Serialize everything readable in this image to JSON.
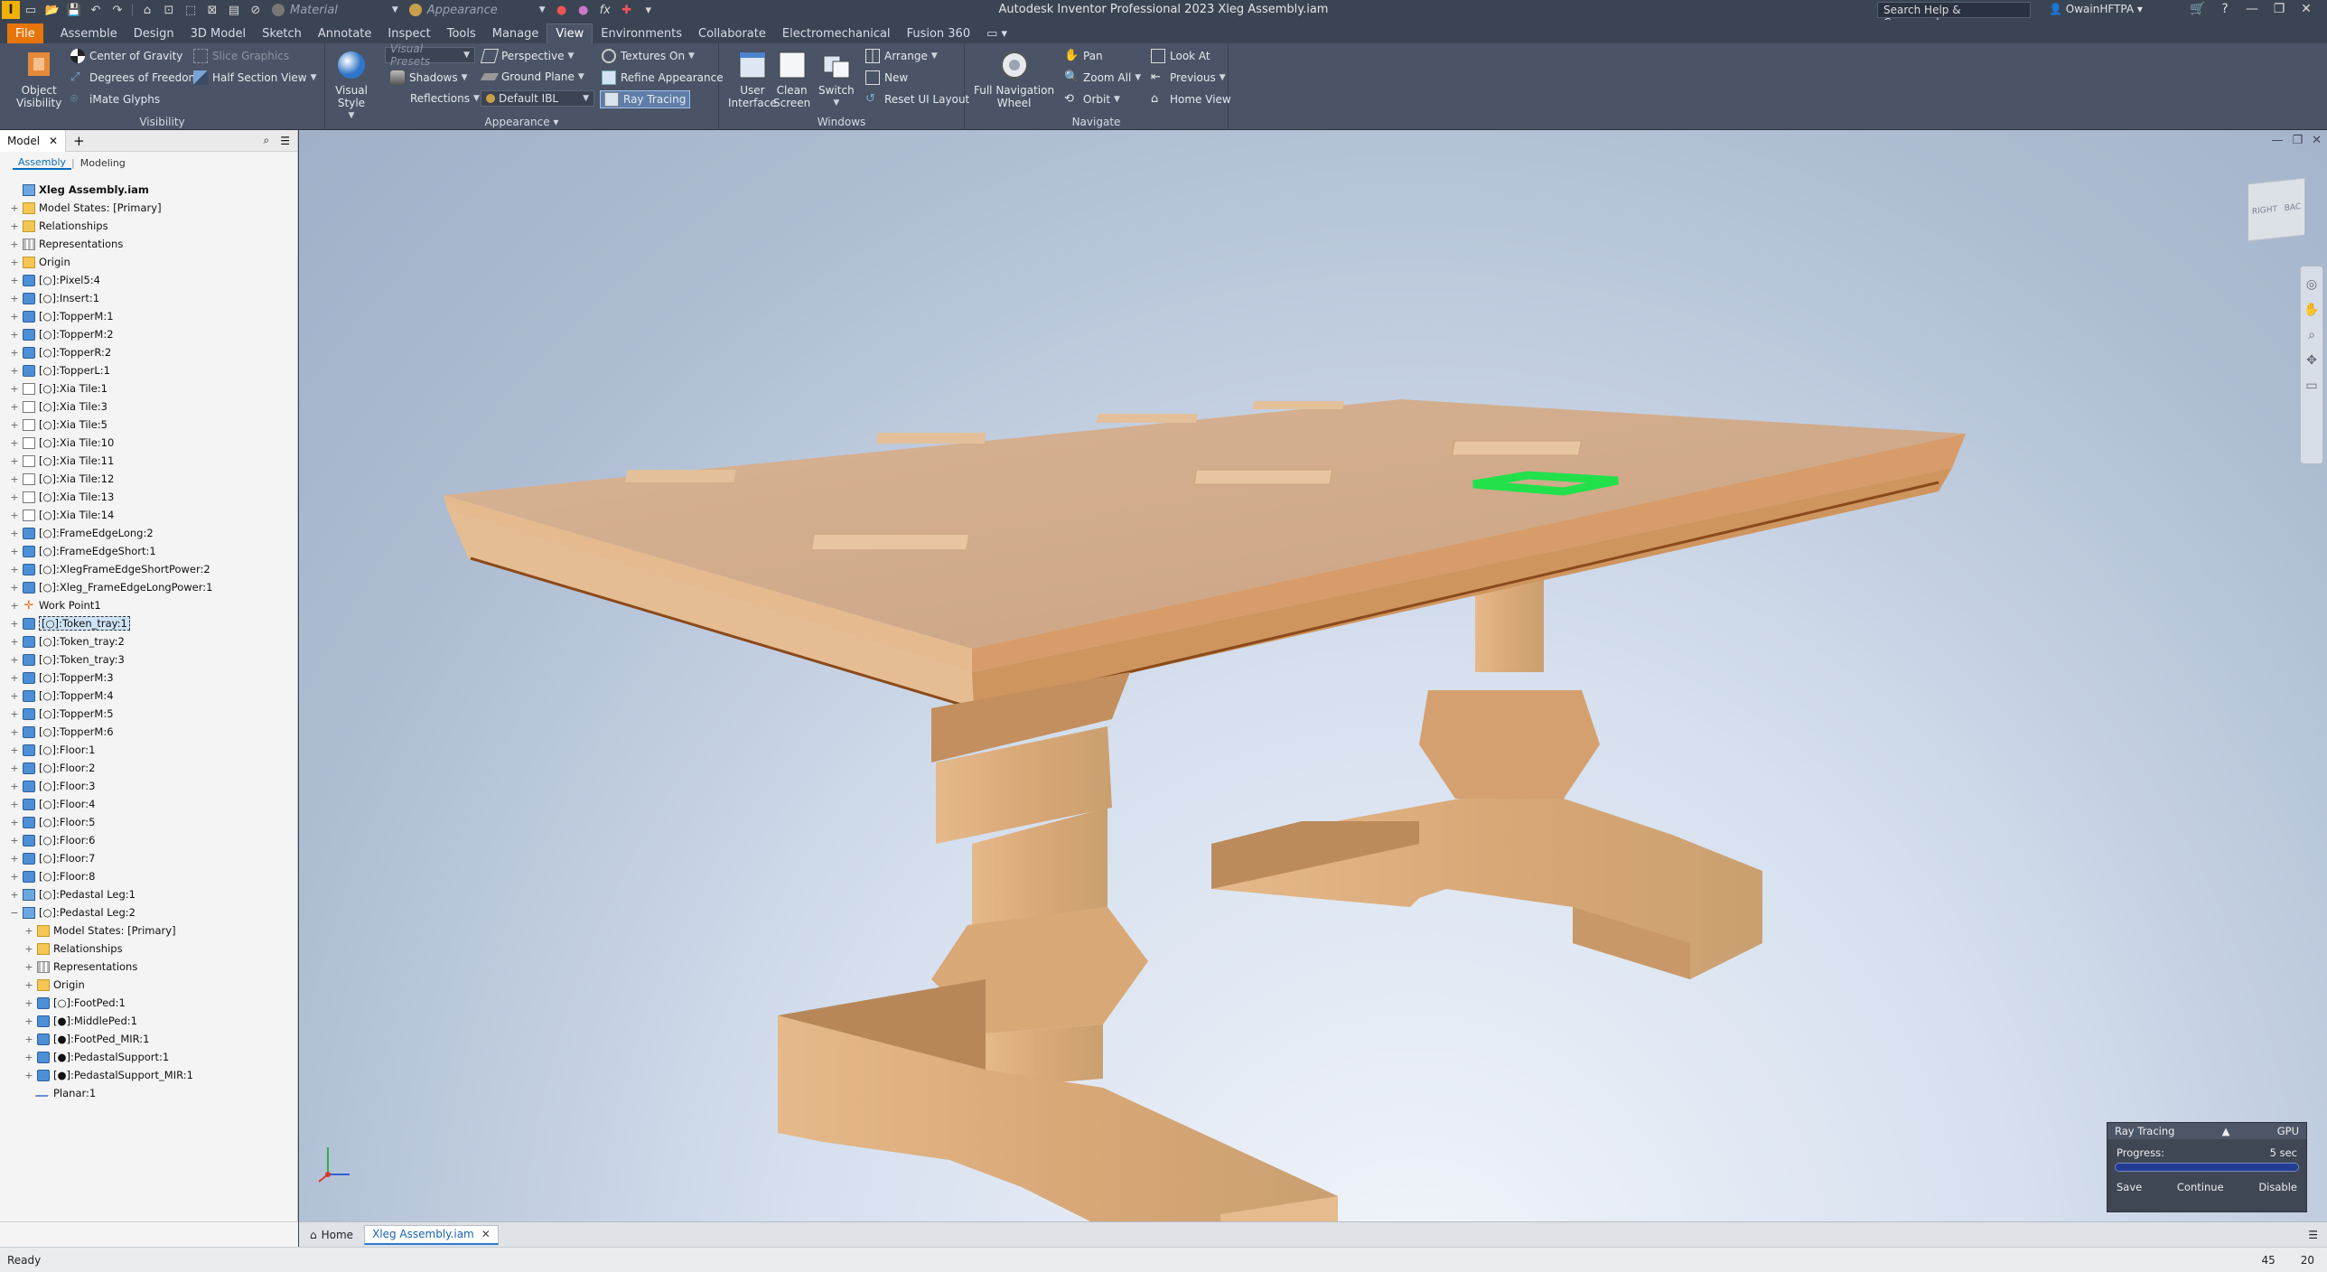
{
  "titlebar": {
    "title": "Autodesk Inventor Professional 2023   Xleg Assembly.iam",
    "material": "Material",
    "appearance": "Appearance",
    "search_placeholder": "Search Help & Commands...",
    "user": "OwainHFTPA"
  },
  "menu": {
    "file": "File",
    "tabs": [
      "Assemble",
      "Design",
      "3D Model",
      "Sketch",
      "Annotate",
      "Inspect",
      "Tools",
      "Manage",
      "View",
      "Environments",
      "Collaborate",
      "Electromechanical",
      "Fusion 360"
    ]
  },
  "ribbon": {
    "visibility": {
      "label": "Visibility",
      "object_visibility": "Object\nVisibility",
      "center_of_gravity": "Center of Gravity",
      "slice_graphics": "Slice Graphics",
      "degrees_of_freedom": "Degrees of Freedom",
      "half_section_view": "Half Section View",
      "imate_glyphs": "iMate Glyphs"
    },
    "appearance": {
      "label": "Appearance",
      "visual_style": "Visual Style",
      "visual_presets": "Visual Presets",
      "perspective": "Perspective",
      "shadows": "Shadows",
      "reflections": "Reflections",
      "ground_plane": "Ground Plane",
      "default_ibl": "Default IBL",
      "textures_on": "Textures On",
      "refine_appearance": "Refine Appearance",
      "ray_tracing": "Ray Tracing"
    },
    "windows": {
      "label": "Windows",
      "user_interface": "User\nInterface",
      "clean_screen": "Clean\nScreen",
      "switch": "Switch",
      "arrange": "Arrange",
      "new": "New",
      "reset_ui_layout": "Reset UI Layout"
    },
    "navigate": {
      "label": "Navigate",
      "full_navigation_wheel": "Full Navigation\nWheel",
      "pan": "Pan",
      "zoom_all": "Zoom All",
      "orbit": "Orbit",
      "look_at": "Look At",
      "previous": "Previous",
      "home_view": "Home View"
    }
  },
  "browser": {
    "tab": "Model",
    "assembly": "Assembly",
    "modeling": "Modeling",
    "items": [
      {
        "label": "Xleg Assembly.iam",
        "icon": "asm",
        "depth": 0,
        "bold": true
      },
      {
        "label": "Model States: [Primary]",
        "icon": "folder",
        "depth": 0,
        "exp": "+"
      },
      {
        "label": "Relationships",
        "icon": "folder",
        "depth": 0,
        "exp": "+"
      },
      {
        "label": "Representations",
        "icon": "grid",
        "depth": 0,
        "exp": "+"
      },
      {
        "label": "Origin",
        "icon": "folder",
        "depth": 0,
        "exp": "+"
      },
      {
        "label": "[○]:Pixel5:4",
        "icon": "part",
        "depth": 0,
        "exp": "+"
      },
      {
        "label": "[○]:Insert:1",
        "icon": "part",
        "depth": 0,
        "exp": "+"
      },
      {
        "label": "[○]:TopperM:1",
        "icon": "part",
        "depth": 0,
        "exp": "+"
      },
      {
        "label": "[○]:TopperM:2",
        "icon": "part",
        "depth": 0,
        "exp": "+"
      },
      {
        "label": "[○]:TopperR:2",
        "icon": "part",
        "depth": 0,
        "exp": "+"
      },
      {
        "label": "[○]:TopperL:1",
        "icon": "part",
        "depth": 0,
        "exp": "+"
      },
      {
        "label": "[○]:Xia Tile:1",
        "icon": "ws",
        "depth": 0,
        "exp": "+"
      },
      {
        "label": "[○]:Xia Tile:3",
        "icon": "ws",
        "depth": 0,
        "exp": "+"
      },
      {
        "label": "[○]:Xia Tile:5",
        "icon": "ws",
        "depth": 0,
        "exp": "+"
      },
      {
        "label": "[○]:Xia Tile:10",
        "icon": "ws",
        "depth": 0,
        "exp": "+"
      },
      {
        "label": "[○]:Xia Tile:11",
        "icon": "ws",
        "depth": 0,
        "exp": "+"
      },
      {
        "label": "[○]:Xia Tile:12",
        "icon": "ws",
        "depth": 0,
        "exp": "+"
      },
      {
        "label": "[○]:Xia Tile:13",
        "icon": "ws",
        "depth": 0,
        "exp": "+"
      },
      {
        "label": "[○]:Xia Tile:14",
        "icon": "ws",
        "depth": 0,
        "exp": "+"
      },
      {
        "label": "[○]:FrameEdgeLong:2",
        "icon": "part",
        "depth": 0,
        "exp": "+"
      },
      {
        "label": "[○]:FrameEdgeShort:1",
        "icon": "part",
        "depth": 0,
        "exp": "+"
      },
      {
        "label": "[○]:XlegFrameEdgeShortPower:2",
        "icon": "part",
        "depth": 0,
        "exp": "+"
      },
      {
        "label": "[○]:Xleg_FrameEdgeLongPower:1",
        "icon": "part",
        "depth": 0,
        "exp": "+"
      },
      {
        "label": "Work Point1",
        "icon": "wp",
        "depth": 0,
        "exp": "+"
      },
      {
        "label": "[○]:Token_tray:1",
        "icon": "part",
        "depth": 0,
        "exp": "+",
        "sel": true
      },
      {
        "label": "[○]:Token_tray:2",
        "icon": "part",
        "depth": 0,
        "exp": "+"
      },
      {
        "label": "[○]:Token_tray:3",
        "icon": "part",
        "depth": 0,
        "exp": "+"
      },
      {
        "label": "[○]:TopperM:3",
        "icon": "part",
        "depth": 0,
        "exp": "+"
      },
      {
        "label": "[○]:TopperM:4",
        "icon": "part",
        "depth": 0,
        "exp": "+"
      },
      {
        "label": "[○]:TopperM:5",
        "icon": "part",
        "depth": 0,
        "exp": "+"
      },
      {
        "label": "[○]:TopperM:6",
        "icon": "part",
        "depth": 0,
        "exp": "+"
      },
      {
        "label": "[○]:Floor:1",
        "icon": "part",
        "depth": 0,
        "exp": "+"
      },
      {
        "label": "[○]:Floor:2",
        "icon": "part",
        "depth": 0,
        "exp": "+"
      },
      {
        "label": "[○]:Floor:3",
        "icon": "part",
        "depth": 0,
        "exp": "+"
      },
      {
        "label": "[○]:Floor:4",
        "icon": "part",
        "depth": 0,
        "exp": "+"
      },
      {
        "label": "[○]:Floor:5",
        "icon": "part",
        "depth": 0,
        "exp": "+"
      },
      {
        "label": "[○]:Floor:6",
        "icon": "part",
        "depth": 0,
        "exp": "+"
      },
      {
        "label": "[○]:Floor:7",
        "icon": "part",
        "depth": 0,
        "exp": "+"
      },
      {
        "label": "[○]:Floor:8",
        "icon": "part",
        "depth": 0,
        "exp": "+"
      },
      {
        "label": "[○]:Pedastal Leg:1",
        "icon": "asm",
        "depth": 0,
        "exp": "+"
      },
      {
        "label": "[○]:Pedastal Leg:2",
        "icon": "asm",
        "depth": 0,
        "exp": "−"
      },
      {
        "label": "Model States: [Primary]",
        "icon": "folder",
        "depth": 1,
        "exp": "+"
      },
      {
        "label": "Relationships",
        "icon": "folder",
        "depth": 1,
        "exp": "+"
      },
      {
        "label": "Representations",
        "icon": "grid",
        "depth": 1,
        "exp": "+"
      },
      {
        "label": "Origin",
        "icon": "folder",
        "depth": 1,
        "exp": "+"
      },
      {
        "label": "[○]:FootPed:1",
        "icon": "part",
        "depth": 1,
        "exp": "+"
      },
      {
        "label": "[●]:MiddlePed:1",
        "icon": "part",
        "depth": 1,
        "exp": "+"
      },
      {
        "label": "[●]:FootPed_MIR:1",
        "icon": "part",
        "depth": 1,
        "exp": "+"
      },
      {
        "label": "[●]:PedastalSupport:1",
        "icon": "part",
        "depth": 1,
        "exp": "+"
      },
      {
        "label": "[●]:PedastalSupport_MIR:1",
        "icon": "part",
        "depth": 1,
        "exp": "+"
      },
      {
        "label": "Planar:1",
        "icon": "planar",
        "depth": 1,
        "exp": ""
      }
    ]
  },
  "viewcube": {
    "right": "RIGHT",
    "back": "BAC"
  },
  "ray_tracing_panel": {
    "title": "Ray Tracing",
    "mode": "GPU",
    "progress_label": "Progress:",
    "time": "5 sec",
    "progress": 1.0,
    "save": "Save",
    "continue": "Continue",
    "disable": "Disable"
  },
  "doc_tabs": {
    "home": "Home",
    "active": "Xleg Assembly.iam"
  },
  "status": {
    "text": "Ready",
    "count1": "45",
    "count2": "20"
  },
  "colors": {
    "accent_file": "#e8750a",
    "wood": "#d9a877",
    "highlight": "#22e04a"
  }
}
